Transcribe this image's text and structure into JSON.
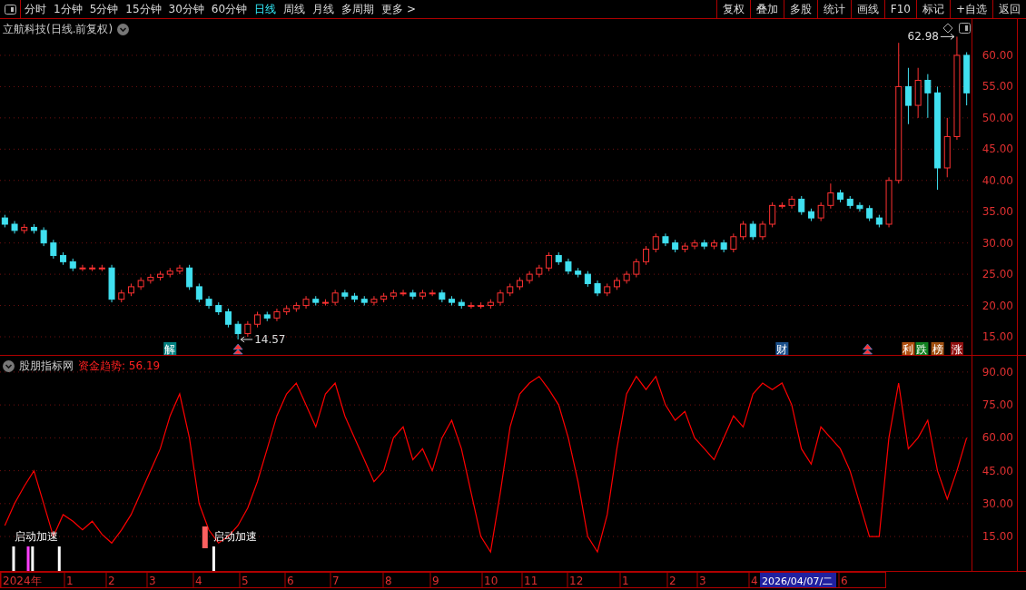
{
  "toolbar": {
    "periods": [
      {
        "label": "分时",
        "selected": false
      },
      {
        "label": "1分钟",
        "selected": false
      },
      {
        "label": "5分钟",
        "selected": false
      },
      {
        "label": "15分钟",
        "selected": false
      },
      {
        "label": "30分钟",
        "selected": false
      },
      {
        "label": "60分钟",
        "selected": false
      },
      {
        "label": "日线",
        "selected": true
      },
      {
        "label": "周线",
        "selected": false
      },
      {
        "label": "月线",
        "selected": false
      },
      {
        "label": "多周期",
        "selected": false
      },
      {
        "label": "更多 >",
        "selected": false
      }
    ],
    "tools": [
      "复权",
      "叠加",
      "多股",
      "统计",
      "画线",
      "F10",
      "标记",
      "+自选",
      "返回"
    ]
  },
  "price": {
    "title": "立航科技(日线.前复权)",
    "chart_data": {
      "type": "candlestick",
      "grid": true,
      "ylim": [
        12.1,
        65.8
      ],
      "yticks": [
        {
          "value": 15,
          "label": "15.00"
        },
        {
          "value": 20,
          "label": "20.00"
        },
        {
          "value": 25,
          "label": "25.00"
        },
        {
          "value": 30,
          "label": "30.00"
        },
        {
          "value": 35,
          "label": "35.00"
        },
        {
          "value": 40,
          "label": "40.00"
        },
        {
          "value": 45,
          "label": "45.00"
        },
        {
          "value": 50,
          "label": "50.00"
        },
        {
          "value": 55,
          "label": "55.00"
        },
        {
          "value": 60,
          "label": "60.00"
        }
      ],
      "ohlc": [
        [
          34,
          34.5,
          32.5,
          33
        ],
        [
          33,
          33.5,
          31.5,
          32
        ],
        [
          32,
          33,
          31.5,
          32.5
        ],
        [
          32.5,
          33,
          31.5,
          32
        ],
        [
          32,
          32.5,
          29.5,
          30
        ],
        [
          30,
          30.5,
          27.5,
          28
        ],
        [
          28,
          28.5,
          26.5,
          27
        ],
        [
          27,
          27.5,
          25.5,
          26
        ],
        [
          26,
          26.5,
          25.5,
          26
        ],
        [
          26,
          26.5,
          25.5,
          26
        ],
        [
          26,
          26.5,
          25.5,
          26
        ],
        [
          26,
          26.5,
          20.5,
          21
        ],
        [
          21,
          22.5,
          20.5,
          22
        ],
        [
          22,
          23.5,
          21.5,
          23
        ],
        [
          23,
          24.5,
          22.5,
          24
        ],
        [
          24,
          25,
          23.5,
          24.5
        ],
        [
          24.5,
          25.5,
          24,
          25
        ],
        [
          25,
          26,
          24.5,
          25.5
        ],
        [
          25.5,
          26.5,
          25,
          26
        ],
        [
          26,
          26.5,
          22.5,
          23
        ],
        [
          23,
          23.5,
          20.5,
          21
        ],
        [
          21,
          21.5,
          19.5,
          20
        ],
        [
          20,
          20.5,
          18.5,
          19
        ],
        [
          19,
          19.5,
          16.5,
          17
        ],
        [
          17,
          17.5,
          14.57,
          15.5
        ],
        [
          15.5,
          17.5,
          15,
          17
        ],
        [
          17,
          19,
          16.5,
          18.5
        ],
        [
          18.5,
          19,
          17.5,
          18
        ],
        [
          18,
          19.5,
          17.5,
          19
        ],
        [
          19,
          20,
          18.5,
          19.5
        ],
        [
          19.5,
          20.5,
          19,
          20
        ],
        [
          20,
          21.5,
          19.5,
          21
        ],
        [
          21,
          21.5,
          20,
          20.5
        ],
        [
          20.5,
          21,
          20,
          20.5
        ],
        [
          20.5,
          22.5,
          20,
          22
        ],
        [
          22,
          22.5,
          21,
          21.5
        ],
        [
          21.5,
          22,
          20.5,
          21
        ],
        [
          21,
          21.5,
          20,
          20.5
        ],
        [
          20.5,
          21.5,
          20,
          21
        ],
        [
          21,
          22,
          20.5,
          21.5
        ],
        [
          21.5,
          22.5,
          21,
          22
        ],
        [
          22,
          22.5,
          21.5,
          22
        ],
        [
          22,
          22.5,
          21,
          21.5
        ],
        [
          21.5,
          22.5,
          21,
          22
        ],
        [
          22,
          22.5,
          21.5,
          22
        ],
        [
          22,
          22.5,
          20.5,
          21
        ],
        [
          21,
          21.5,
          20,
          20.5
        ],
        [
          20.5,
          21,
          19.5,
          20
        ],
        [
          20,
          20.5,
          19.5,
          20
        ],
        [
          20,
          20.5,
          19.5,
          20
        ],
        [
          20,
          21,
          19.5,
          20.5
        ],
        [
          20.5,
          22.5,
          20,
          22
        ],
        [
          22,
          23.5,
          21.5,
          23
        ],
        [
          23,
          24.5,
          22.5,
          24
        ],
        [
          24,
          25.5,
          23.5,
          25
        ],
        [
          25,
          26.5,
          24.5,
          26
        ],
        [
          26,
          28.5,
          25.5,
          28
        ],
        [
          28,
          28.5,
          26.5,
          27
        ],
        [
          27,
          27.5,
          25,
          25.5
        ],
        [
          25.5,
          26,
          24.5,
          25
        ],
        [
          25,
          25.5,
          23,
          23.5
        ],
        [
          23.5,
          24,
          21.5,
          22
        ],
        [
          22,
          23.5,
          21.5,
          23
        ],
        [
          23,
          24.5,
          22.5,
          24
        ],
        [
          24,
          25.5,
          23.5,
          25
        ],
        [
          25,
          27.5,
          24.5,
          27
        ],
        [
          27,
          29.5,
          26.5,
          29
        ],
        [
          29,
          31.5,
          28.5,
          31
        ],
        [
          31,
          31.5,
          29.5,
          30
        ],
        [
          30,
          30.5,
          28.5,
          29
        ],
        [
          29,
          30,
          28.5,
          29.5
        ],
        [
          29.5,
          30.5,
          29,
          30
        ],
        [
          30,
          30.5,
          29,
          29.5
        ],
        [
          29.5,
          30.5,
          29,
          30
        ],
        [
          30,
          30.5,
          28.5,
          29
        ],
        [
          29,
          31.5,
          28.5,
          31
        ],
        [
          31,
          33.5,
          30.5,
          33
        ],
        [
          33,
          33.5,
          30.5,
          31
        ],
        [
          31,
          33.5,
          30.5,
          33
        ],
        [
          33,
          36.5,
          32.5,
          36
        ],
        [
          36,
          36.5,
          35.5,
          36
        ],
        [
          36,
          37.5,
          35.5,
          37
        ],
        [
          37,
          37.5,
          34.5,
          35
        ],
        [
          35,
          35.5,
          33.5,
          34
        ],
        [
          34,
          36.5,
          33.5,
          36
        ],
        [
          36,
          39.5,
          35.5,
          38
        ],
        [
          38,
          38.5,
          36.5,
          37
        ],
        [
          37,
          37.5,
          35.5,
          36
        ],
        [
          36,
          36.5,
          35,
          35.5
        ],
        [
          35.5,
          36,
          33.5,
          34
        ],
        [
          34,
          34.5,
          32.5,
          33
        ],
        [
          33,
          40.5,
          32.5,
          40
        ],
        [
          40,
          62,
          39.5,
          55
        ],
        [
          55,
          58,
          49,
          52
        ],
        [
          52,
          58,
          50,
          56
        ],
        [
          56,
          57,
          50,
          54
        ],
        [
          54,
          55,
          38.5,
          42
        ],
        [
          42,
          50,
          40.5,
          47
        ],
        [
          47,
          62.98,
          46.5,
          60
        ],
        [
          60,
          60.5,
          52,
          54
        ]
      ],
      "annotations": [
        "62.98",
        "14.57"
      ]
    },
    "events": [
      {
        "text": "解",
        "color": "#008080"
      },
      {
        "text": "财",
        "color": "#1a4f8a"
      },
      {
        "text": "利",
        "color": "#b05010"
      },
      {
        "text": "跌",
        "color": "#108020"
      },
      {
        "text": "榜",
        "color": "#a05010"
      },
      {
        "text": "涨",
        "color": "#901010"
      }
    ]
  },
  "indicator": {
    "name": "股朋指标网",
    "reading": "资金趋势: 56.19",
    "chart_data": {
      "type": "line",
      "grid": true,
      "ylim": [
        -0.7,
        97.4
      ],
      "yticks": [
        {
          "value": 15,
          "label": "15.00"
        },
        {
          "value": 30,
          "label": "30.00"
        },
        {
          "value": 45,
          "label": "45.00"
        },
        {
          "value": 60,
          "label": "60.00"
        },
        {
          "value": 75,
          "label": "75.00"
        },
        {
          "value": 90,
          "label": "90.00"
        }
      ],
      "series": [
        {
          "color": "#ff0000",
          "values": [
            20,
            30,
            38,
            45,
            30,
            15,
            25,
            22,
            18,
            22,
            16,
            12,
            18,
            25,
            35,
            45,
            55,
            70,
            80,
            60,
            30,
            18,
            12,
            15,
            20,
            28,
            40,
            55,
            70,
            80,
            85,
            75,
            65,
            80,
            85,
            70,
            60,
            50,
            40,
            45,
            60,
            65,
            50,
            55,
            45,
            60,
            68,
            55,
            35,
            15,
            8,
            35,
            65,
            80,
            85,
            88,
            82,
            75,
            60,
            40,
            15,
            8,
            25,
            55,
            80,
            88,
            82,
            88,
            75,
            68,
            72,
            60,
            55,
            50,
            60,
            70,
            65,
            80,
            85,
            82,
            85,
            75,
            55,
            48,
            65,
            60,
            55,
            45,
            30,
            15,
            15,
            60,
            85,
            55,
            60,
            68,
            45,
            32,
            45,
            60
          ]
        }
      ]
    },
    "signals": [
      {
        "kind": "bar",
        "color": "#ffffff"
      },
      {
        "kind": "bar",
        "color": "#ff40ff"
      },
      {
        "kind": "bar",
        "color": "#ffffff"
      },
      {
        "kind": "bar",
        "color": "#ffffff"
      },
      {
        "kind": "block",
        "color": "#ff6060"
      },
      {
        "kind": "bar",
        "color": "#ffffff"
      }
    ],
    "signal_labels": [
      "启动加速",
      "启动加速"
    ]
  },
  "time_axis": {
    "labels": [
      "2024年",
      "1",
      "2",
      "3",
      "4",
      "5",
      "6",
      "7",
      "8",
      "9",
      "10",
      "11",
      "12",
      "1",
      "2",
      "3",
      "4",
      "6"
    ],
    "cursor": "2026/04/07/二"
  }
}
